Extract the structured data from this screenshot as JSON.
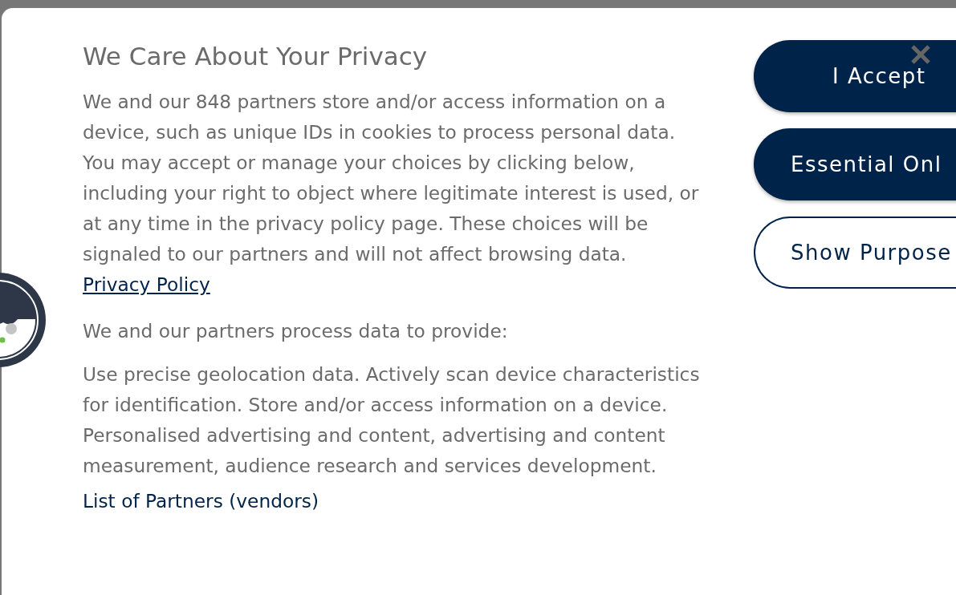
{
  "dialog": {
    "title": "We Care About Your Privacy",
    "intro": {
      "text": "We and our 848 partners store and/or access information on a device, such as unique IDs in cookies to process personal data. You may accept or manage your choices by clicking below, including your right to object where legitimate interest is used, or at any time in the privacy policy page. These choices will be signaled to our partners and will not affect browsing data.",
      "link": "Privacy Policy"
    },
    "purposes_heading": "We and our partners process data to provide:",
    "purposes": "Use precise geolocation data. Actively scan device characteristics for identification. Store and/or access information on a device. Personalised advertising and content, advertising and content measurement, audience research and services development.",
    "partners_link": "List of Partners (vendors)",
    "buttons": [
      {
        "label": "I Accept",
        "kind": "primary"
      },
      {
        "label": "Essential Onl",
        "kind": "primary"
      },
      {
        "label": "Show Purpose",
        "kind": "outline"
      }
    ]
  }
}
